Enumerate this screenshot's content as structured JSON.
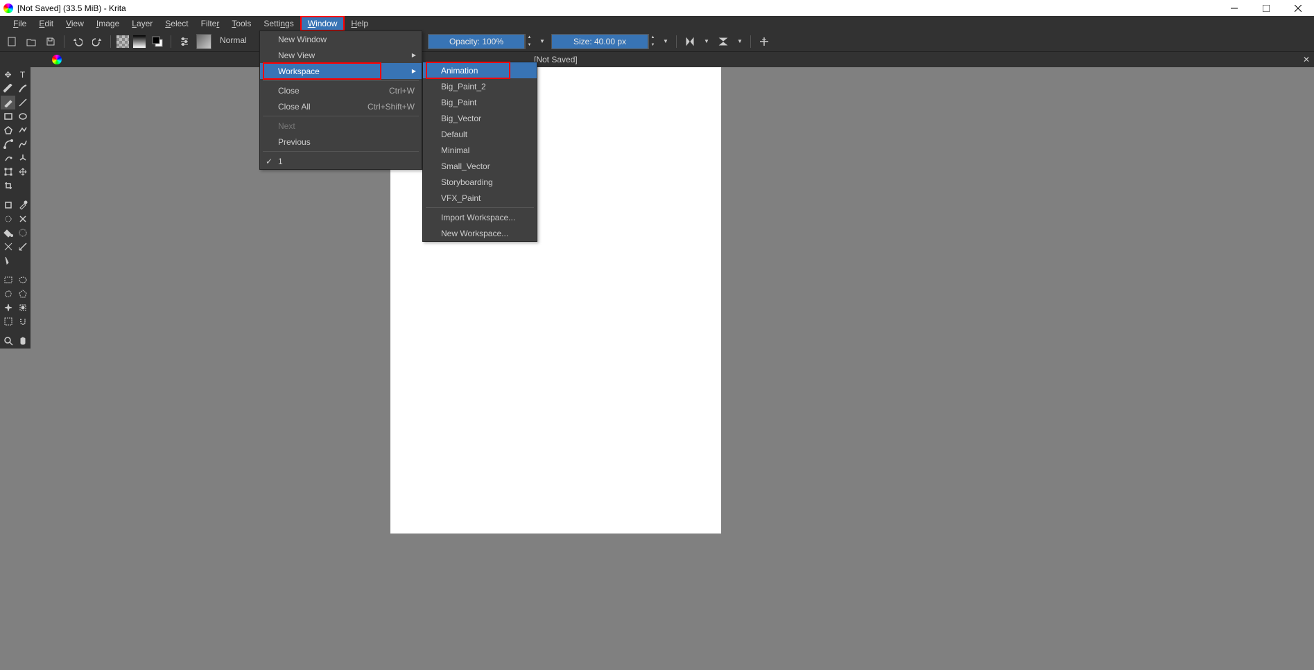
{
  "title_bar": {
    "text": "[Not Saved]  (33.5 MiB)  - Krita"
  },
  "menu": {
    "file": "File",
    "edit": "Edit",
    "view": "View",
    "image": "Image",
    "layer": "Layer",
    "select": "Select",
    "filter": "Filter",
    "tools": "Tools",
    "settings": "Settings",
    "window": "Window",
    "help": "Help"
  },
  "toolbar": {
    "blend_mode": "Normal",
    "opacity_label": "Opacity: 100%",
    "size_label": "Size: 40.00 px"
  },
  "tab": {
    "label": "[Not Saved]"
  },
  "window_menu": {
    "new_window": "New Window",
    "new_view": "New View",
    "workspace": "Workspace",
    "close": "Close",
    "close_sc": "Ctrl+W",
    "close_all": "Close All",
    "close_all_sc": "Ctrl+Shift+W",
    "next": "Next",
    "previous": "Previous",
    "doc1": "1"
  },
  "workspace_menu": {
    "animation": "Animation",
    "big_paint_2": "Big_Paint_2",
    "big_paint": "Big_Paint",
    "big_vector": "Big_Vector",
    "default": "Default",
    "minimal": "Minimal",
    "small_vector": "Small_Vector",
    "storyboarding": "Storyboarding",
    "vfx_paint": "VFX_Paint",
    "import_ws": "Import Workspace...",
    "new_ws": "New Workspace..."
  }
}
